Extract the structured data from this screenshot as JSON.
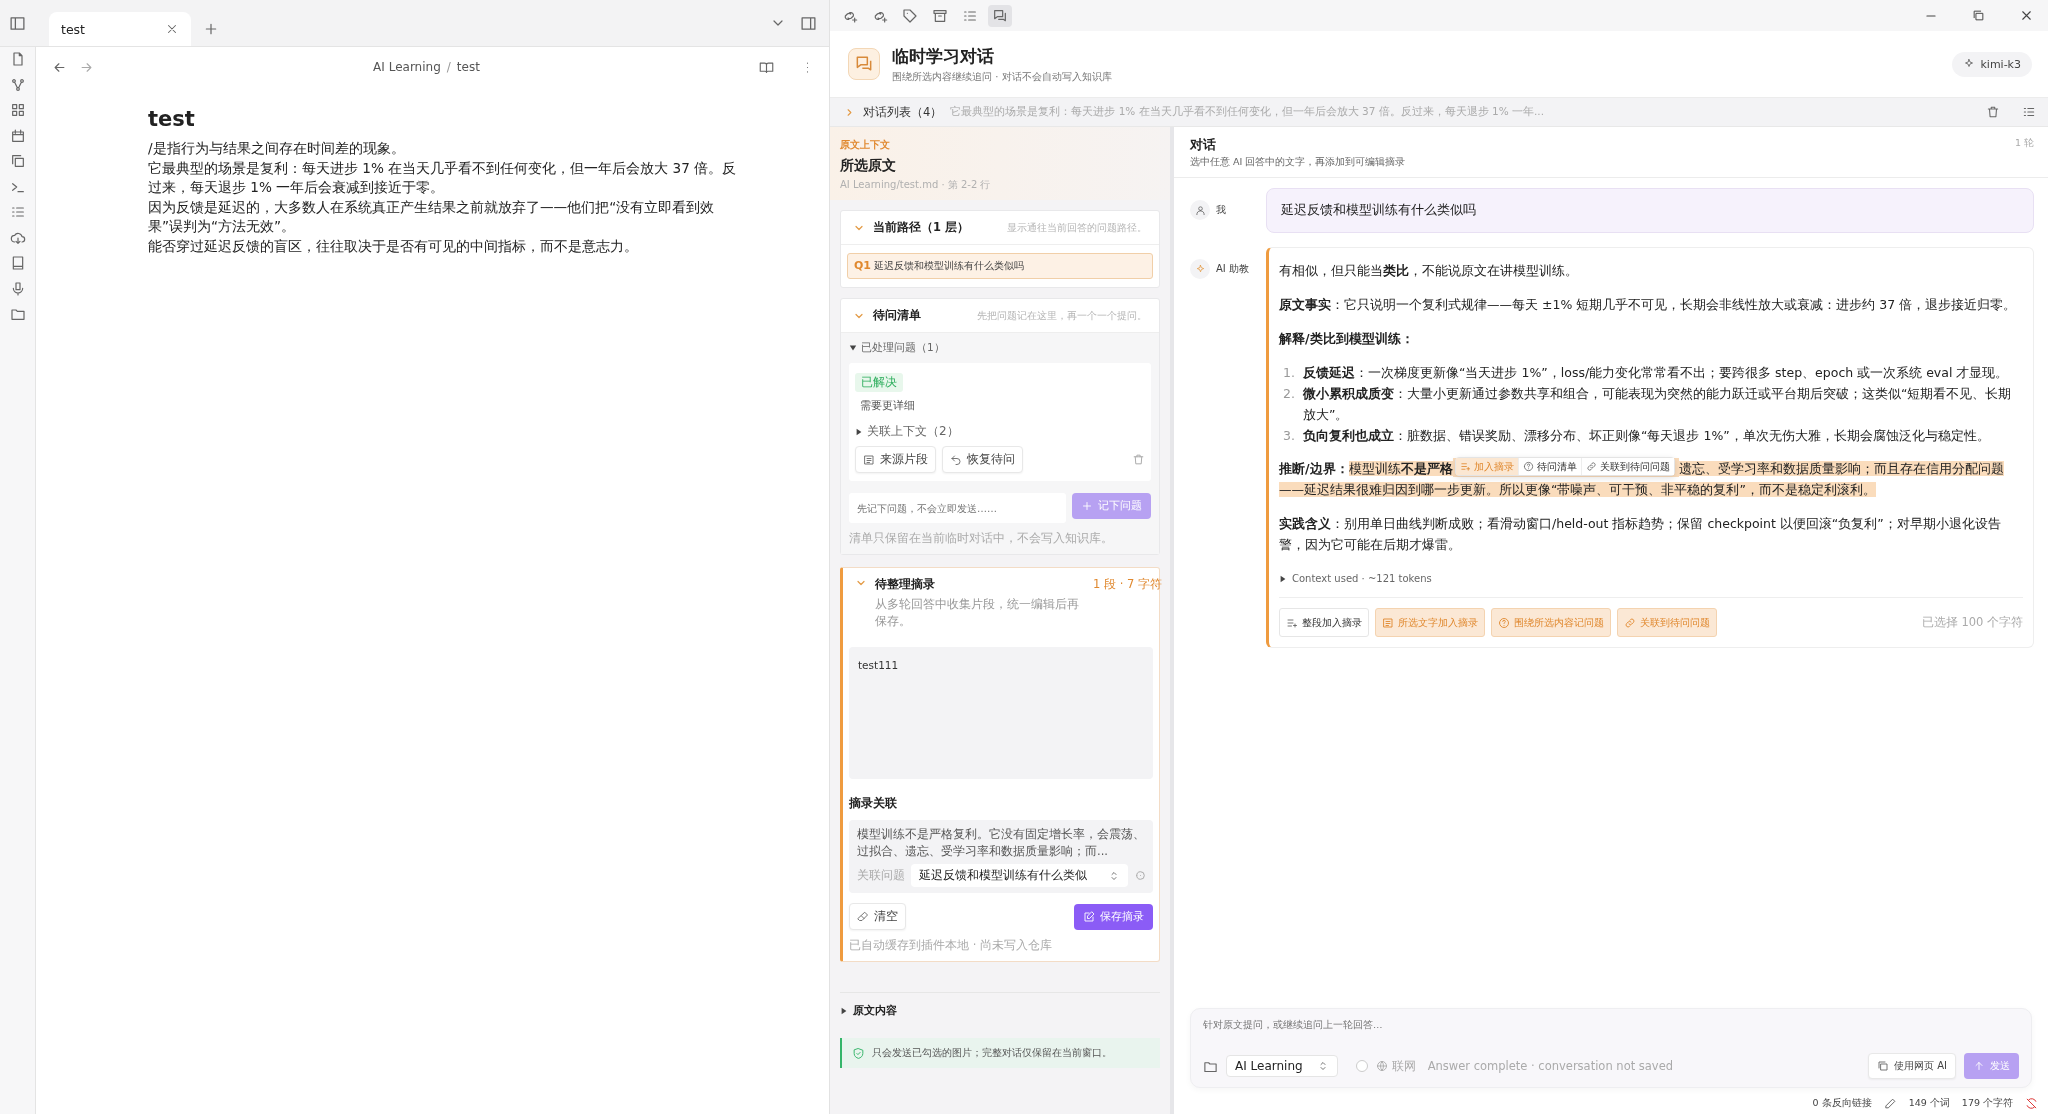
{
  "tabs": [
    {
      "label": "test",
      "selected": true
    }
  ],
  "editor": {
    "breadcrumb": [
      "AI Learning",
      "test"
    ],
    "breadcrumb_separator": "/",
    "title": "test",
    "paragraphs": [
      "/是指行为与结果之间存在时间差的现象。",
      "它最典型的场景是复利：每天进步 1% 在当天几乎看不到任何变化，但一年后会放大 37 倍。反过来，每天退步 1% 一年后会衰减到接近于零。",
      "因为反馈是延迟的，大多数人在系统真正产生结果之前就放弃了——他们把“没有立即看到效果”误判为“方法无效”。",
      "能否穿过延迟反馈的盲区，往往取决于是否有可见的中间指标，而不是意志力。"
    ]
  },
  "toolbar": [
    {
      "kind": "link-plus",
      "selected": false
    },
    {
      "kind": "link-plus",
      "selected": false
    },
    {
      "kind": "tag",
      "selected": false
    },
    {
      "kind": "archive",
      "selected": false
    },
    {
      "kind": "list",
      "selected": false
    },
    {
      "kind": "chat",
      "selected": true
    }
  ],
  "chat_header": {
    "title": "临时学习对话",
    "subtitle": "围绕所选内容继续追问 · 对话不会自动写入知识库",
    "model": "kimi-k3"
  },
  "conversation_list": {
    "label": "对话列表（4）",
    "expanded": false,
    "preview": "它最典型的场景是复利：每天进步 1% 在当天几乎看不到任何变化，但一年后会放大 37 倍。反过来，每天退步 1% 一年..."
  },
  "context": {
    "eyebrow": "原文上下文",
    "title": "所选原文",
    "source": "AI Learning/test.md · 第 2-2 行",
    "path": {
      "title": "当前路径（1 层）",
      "hint": "显示通往当前回答的问题路径。",
      "expanded": true,
      "items": [
        {
          "index": "Q1",
          "text": "延迟反馈和模型训练有什么类似吗"
        }
      ]
    },
    "queue": {
      "title": "待问清单",
      "hint": "先把问题记在这里，再一个一个提问。",
      "expanded": true,
      "handled": {
        "label": "已处理问题（1）",
        "expanded": true,
        "items": [
          {
            "status": "已解决",
            "text": "需要更详细",
            "related": {
              "label": "关联上下文（2）",
              "expanded": false
            },
            "buttons": [
              "来源片段",
              "恢复待问"
            ]
          }
        ]
      },
      "input": {
        "placeholder": "先记下问题，不会立即发送……"
      },
      "add_button": {
        "label": "记下问题",
        "disabled": true
      },
      "note": "清单只保留在当前临时对话中，不会写入知识库。"
    },
    "excerpt": {
      "title": "待整理摘录",
      "expanded": true,
      "count": "1 段 · 7 字符",
      "description": "从多轮回答中收集片段，统一编辑后再保存。",
      "value": "test111",
      "link_title": "摘录关联",
      "link_text": "模型训练不是严格复利。它没有固定增长率，会震荡、过拟合、遗忘、受学习率和数据质量影响；而...",
      "question_label": "关联问题",
      "question_value": "延迟反馈和模型训练有什么类似",
      "clear_button": "清空",
      "save_button": {
        "label": "保存摘录",
        "disabled": false
      },
      "note": "已自动缓存到插件本地 · 尚未写入仓库"
    },
    "original": {
      "label": "原文内容",
      "expanded": false
    },
    "notice": "只会发送已勾选的图片；完整对话仅保留在当前窗口。"
  },
  "chat": {
    "title": "对话",
    "subtitle": "选中任意 AI 回答中的文字，再添加到可编辑摘录",
    "rounds": "1 轮",
    "user": {
      "name": "我",
      "text": "延迟反馈和模型训练有什么类似吗"
    },
    "assistant": {
      "name": "AI 助教",
      "blocks": [
        {
          "kind": "p",
          "text": "有相似，但只能当**类比**，不能说原文在讲模型训练。"
        },
        {
          "kind": "p",
          "text": "**原文事实**：它只说明一个复利式规律——每天 ±1% 短期几乎不可见，长期会非线性放大或衰减：进步约 37 倍，退步接近归零。"
        },
        {
          "kind": "heading",
          "text": "解释/类比到模型训练："
        },
        {
          "kind": "ol",
          "items": [
            {
              "number": "1.",
              "text": "**反馈延迟**：一次梯度更新像“当天进步 1%”，loss/能力变化常常看不出；要跨很多 step、epoch 或一次系统 eval 才显现。"
            },
            {
              "number": "2.",
              "text": "**微小累积成质变**：大量小更新通过参数共享和组合，可能表现为突然的能力跃迁或平台期后突破；这类似“短期看不见、长期放大”。"
            },
            {
              "number": "3.",
              "text": "**负向复利也成立**：脏数据、错误奖励、漂移分布、坏正则像“每天退步 1%”，单次无伤大雅，长期会腐蚀泛化与稳定性。"
            }
          ]
        },
        {
          "kind": "highlight",
          "lead": "推断/边界：",
          "before": "模型训练**不是严格**",
          "after_line1": "遗忘、受学习率和数据质量影响；而且存在信用分配问题",
          "after_line2": "——延迟结果很难归因到哪一步更新。所以更像“带噪声、可干预、非平稳的复利”，而不是稳定利滚利。",
          "popup": [
            "加入摘录",
            "待问清单",
            "关联到待问问题"
          ]
        },
        {
          "kind": "p",
          "text": "**实践含义**：别用单日曲线判断成败；看滑动窗口/held-out 指标趋势；保留 checkpoint 以便回滚“负复利”；对早期小退化设告警，因为它可能在后期才爆雷。"
        }
      ],
      "context_used": {
        "label": "Context used · ~121 tokens",
        "expanded": false
      },
      "actions": [
        "整段加入摘录",
        "所选文字加入摘录",
        "围绕所选内容记问题",
        "关联到待问问题"
      ],
      "selection": "已选择 100 个字符"
    }
  },
  "composer": {
    "placeholder": "针对原文提问，或继续追问上一轮回答…",
    "vault": "AI Learning",
    "web": {
      "label": "联网",
      "checked": false
    },
    "status": "Answer complete · conversation not saved",
    "web_ai_button": "使用网页 AI",
    "send_button": {
      "label": "发送",
      "disabled": true
    }
  },
  "status_bar": {
    "backlinks": "0 条反向链接",
    "words": "149 个词",
    "chars": "179 个字符"
  }
}
